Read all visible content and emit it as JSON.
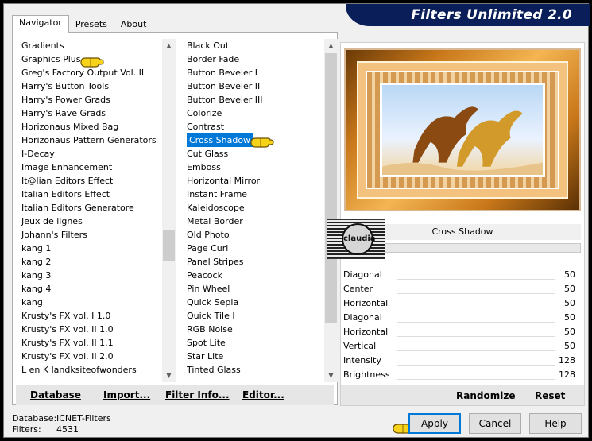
{
  "window": {
    "title": "Filters Unlimited 2.0"
  },
  "tabs": [
    "Navigator",
    "Presets",
    "About"
  ],
  "categories": [
    "Gradients",
    "Graphics Plus",
    "Greg's Factory Output Vol. II",
    "Harry's Button Tools",
    "Harry's Power Grads",
    "Harry's Rave Grads",
    "Horizonaus Mixed Bag",
    "Horizonaus Pattern Generators",
    "I-Decay",
    "Image Enhancement",
    "It@lian Editors Effect",
    "Italian Editors Effect",
    "Italian Editors Generatore",
    "Jeux de lignes",
    "Johann's Filters",
    "kang 1",
    "kang 2",
    "kang 3",
    "kang 4",
    "kang",
    "Krusty's FX vol. I 1.0",
    "Krusty's FX vol. II 1.0",
    "Krusty's FX vol. II 1.1",
    "Krusty's FX vol. II 2.0",
    "L en K landksiteofwonders"
  ],
  "filters": [
    "Black Out",
    "Border Fade",
    "Button Beveler I",
    "Button Beveler II",
    "Button Beveler III",
    "Colorize",
    "Contrast",
    "Cross Shadow",
    "Cut Glass",
    "Emboss",
    "Horizontal Mirror",
    "Instant Frame",
    "Kaleidoscope",
    "Metal Border",
    "Old Photo",
    "Page Curl",
    "Panel Stripes",
    "Peacock",
    "Pin Wheel",
    "Quick Sepia",
    "Quick Tile I",
    "RGB Noise",
    "Spot Lite",
    "Star Lite",
    "Tinted Glass"
  ],
  "selected_filter": "Cross Shadow",
  "left_buttons": {
    "database": "Database",
    "import": "Import...",
    "filter_info": "Filter Info...",
    "editor": "Editor..."
  },
  "preview": {
    "filter_name": "Cross Shadow",
    "watermark": "claudia"
  },
  "params": [
    {
      "name": "Diagonal",
      "value": "50"
    },
    {
      "name": "Center",
      "value": "50"
    },
    {
      "name": "Horizontal",
      "value": "50"
    },
    {
      "name": "Diagonal",
      "value": "50"
    },
    {
      "name": "Horizontal",
      "value": "50"
    },
    {
      "name": "Vertical",
      "value": "50"
    },
    {
      "name": "Intensity",
      "value": "128"
    },
    {
      "name": "Brightness",
      "value": "128"
    }
  ],
  "right_buttons": {
    "randomize": "Randomize",
    "reset": "Reset"
  },
  "status": {
    "database_label": "Database:",
    "database_value": "ICNET-Filters",
    "filters_label": "Filters:",
    "filters_value": "4531"
  },
  "buttons": {
    "apply": "Apply",
    "cancel": "Cancel",
    "help": "Help"
  },
  "colors": {
    "selection": "#0078d7",
    "banner": "#0a1f5a",
    "pointer_hand": "#f3c400"
  }
}
